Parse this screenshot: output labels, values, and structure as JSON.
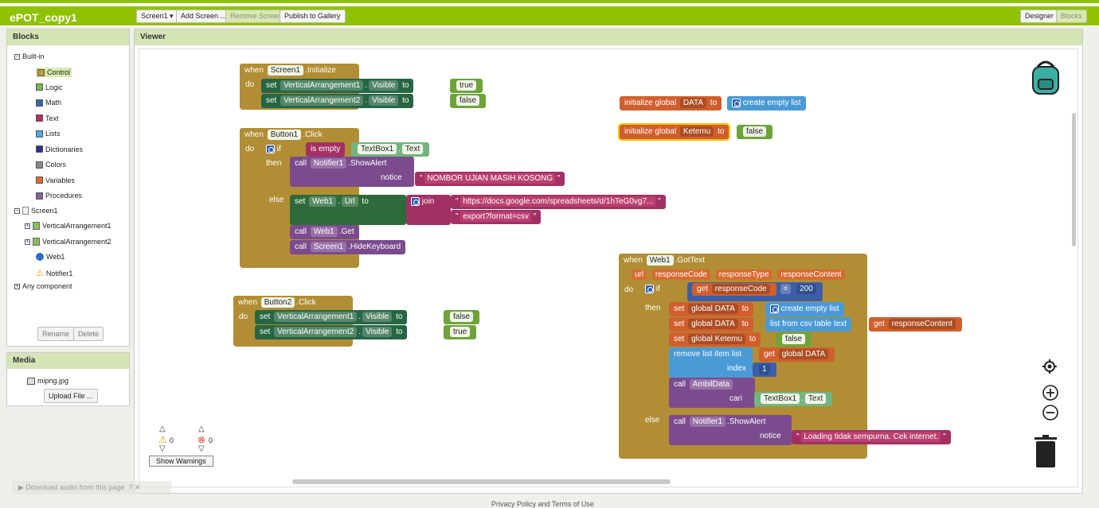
{
  "app": {
    "title": "ePOT_copy1"
  },
  "toolbar": {
    "screen_select": "Screen1 ▾",
    "add_screen": "Add Screen ...",
    "remove_screen": "Remove Screen",
    "publish": "Publish to Gallery",
    "designer": "Designer",
    "blocks": "Blocks"
  },
  "blocks_panel": {
    "title": "Blocks",
    "builtin": "Built-in",
    "builtin_items": [
      {
        "label": "Control",
        "color": "#c49a32"
      },
      {
        "label": "Logic",
        "color": "#7db84a"
      },
      {
        "label": "Math",
        "color": "#3466b0"
      },
      {
        "label": "Text",
        "color": "#b5305f"
      },
      {
        "label": "Lists",
        "color": "#56a6e0"
      },
      {
        "label": "Dictionaries",
        "color": "#2e2e8a"
      },
      {
        "label": "Colors",
        "color": "#8a8a8a"
      },
      {
        "label": "Variables",
        "color": "#e0662e"
      },
      {
        "label": "Procedures",
        "color": "#8c5d9e"
      }
    ],
    "screen": "Screen1",
    "components": [
      "VerticalArrangement1",
      "VerticalArrangement2",
      "Web1",
      "Notifier1"
    ],
    "any": "Any component",
    "rename": "Rename",
    "delete": "Delete"
  },
  "media": {
    "title": "Media",
    "file": "mipng.jpg",
    "upload": "Upload File ..."
  },
  "viewer": {
    "title": "Viewer"
  },
  "warnings": {
    "warn_count": "0",
    "error_count": "0",
    "show_warnings": "Show Warnings"
  },
  "footer": {
    "download_audio": "Download audio from this page",
    "privacy": "Privacy Policy and Terms of Use"
  },
  "blocks": {
    "when": "when",
    "do": "do",
    "set": "set",
    "to": "to",
    "call": "call",
    "if": "if",
    "then": "then",
    "else": "else",
    "get": "get",
    "screen1": "Screen1",
    "initialize": ".Initialize",
    "va1": "VerticalArrangement1",
    "va2": "VerticalArrangement2",
    "visible": "Visible",
    "true": "true",
    "false": "false",
    "button1": "Button1",
    "button2": "Button2",
    "click": ".Click",
    "is_empty": "is empty",
    "textbox1": "TextBox1",
    "text": "Text",
    "notifier1": "Notifier1",
    "show_alert": ".ShowAlert",
    "notice": "notice",
    "nomor_msg": "NOMBOR UJIAN MASIH KOSONG",
    "web1": "Web1",
    "url": "Url",
    "join": "join",
    "url_str": "https://docs.google.com/spreadsheets/d/1hTeG0vg7...",
    "export_str": "export?format=csv",
    "get_call": ".Get",
    "hide_keyboard": ".HideKeyboard",
    "init_global": "initialize global",
    "data": "DATA",
    "create_empty_list": "create empty list",
    "ketemu": "Ketemu",
    "got_text": ".GotText",
    "url_param": "url",
    "response_code": "responseCode",
    "response_type": "responseType",
    "response_content": "responseContent",
    "eq": "=",
    "n200": "200",
    "global_data": "global DATA",
    "global_ketemu": "global Ketemu",
    "list_from_csv": "list from csv table",
    "text_param": "text",
    "remove_list_item": "remove list item",
    "list_param": "list",
    "index": "index",
    "n1": "1",
    "ambil_data": "AmbilData",
    "cari": "cari",
    "loading_msg": "Loading tidak sempurna. Cek internet.",
    "dot": "."
  }
}
